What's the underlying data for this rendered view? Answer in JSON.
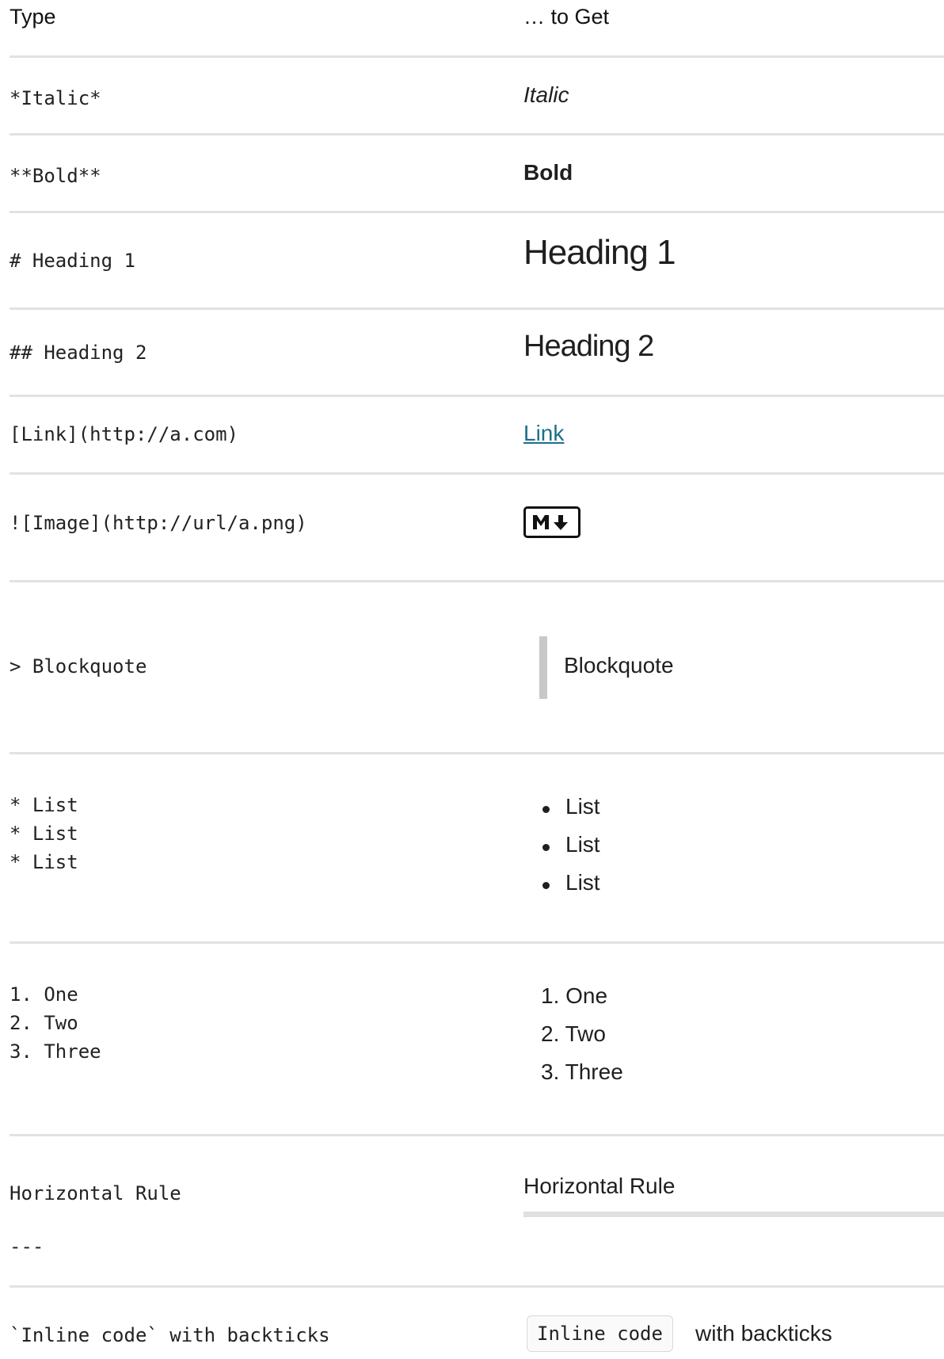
{
  "header": {
    "type_label": "Type",
    "get_label": "… to Get"
  },
  "rows": {
    "italic": {
      "source": "*Italic*",
      "result": "Italic"
    },
    "bold": {
      "source": "**Bold**",
      "result": "Bold"
    },
    "h1": {
      "source": "# Heading 1",
      "result": "Heading 1"
    },
    "h2": {
      "source": "## Heading 2",
      "result": "Heading 2"
    },
    "link": {
      "source": "[Link](http://a.com)",
      "result": "Link"
    },
    "image": {
      "source": "![Image](http://url/a.png)",
      "result_icon": "markdown-logo-icon",
      "logo_text": "M↓"
    },
    "blockquote": {
      "source": "> Blockquote",
      "result": "Blockquote"
    },
    "list": {
      "source": [
        "* List",
        "* List",
        "* List"
      ],
      "result": [
        "List",
        "List",
        "List"
      ]
    },
    "ordered": {
      "source": [
        "1. One",
        "2. Two",
        "3. Three"
      ],
      "result": [
        "1. One",
        "2. Two",
        "3. Three"
      ]
    },
    "hr": {
      "source_line1": "Horizontal Rule",
      "source_line2": "---",
      "result": "Horizontal Rule"
    },
    "code": {
      "source": "`Inline code` with backticks",
      "result_code": "Inline code",
      "result_text": "with backticks"
    }
  },
  "colors": {
    "link": "#1b6f8a",
    "rule": "#e2e2e2",
    "blockquote_bar": "#c8c8c8"
  }
}
